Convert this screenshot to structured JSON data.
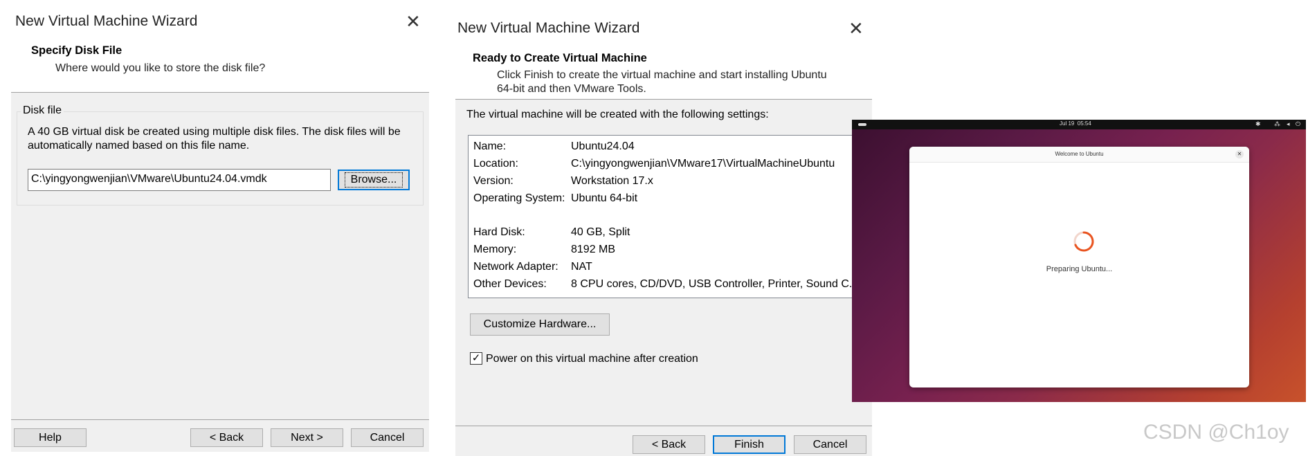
{
  "wizard1": {
    "title": "New Virtual Machine Wizard",
    "section_title": "Specify Disk File",
    "section_subtitle": "Where would you like to store the disk file?",
    "group_label": "Disk file",
    "description_line1": "A 40 GB virtual disk be created using multiple disk files. The disk files will be",
    "description_line2": "automatically named based on this file name.",
    "path_value": "C:\\yingyongwenjian\\VMware\\Ubuntu24.04.vmdk",
    "browse_label": "Browse...",
    "help_label": "Help",
    "back_label": "< Back",
    "next_label": "Next >",
    "cancel_label": "Cancel"
  },
  "wizard2": {
    "title": "New Virtual Machine Wizard",
    "section_title": "Ready to Create Virtual Machine",
    "section_subtitle_line1": "Click Finish to create the virtual machine and start installing Ubuntu",
    "section_subtitle_line2": "64-bit and then VMware Tools.",
    "settings_intro": "The virtual machine will be created with the following settings:",
    "settings": [
      {
        "key": "Name:",
        "value": "Ubuntu24.04"
      },
      {
        "key": "Location:",
        "value": "C:\\yingyongwenjian\\VMware17\\VirtualMachineUbuntu"
      },
      {
        "key": "Version:",
        "value": "Workstation 17.x"
      },
      {
        "key": "Operating System:",
        "value": "Ubuntu 64-bit"
      },
      {
        "key": "Hard Disk:",
        "value": "40 GB, Split"
      },
      {
        "key": "Memory:",
        "value": "8192 MB"
      },
      {
        "key": "Network Adapter:",
        "value": "NAT"
      },
      {
        "key": "Other Devices:",
        "value": "8 CPU cores, CD/DVD, USB Controller, Printer, Sound C..."
      }
    ],
    "customize_label": "Customize Hardware...",
    "power_on_label": "Power on this virtual machine after creation",
    "power_on_checked": true,
    "back_label": "< Back",
    "finish_label": "Finish",
    "cancel_label": "Cancel"
  },
  "ubuntu": {
    "topbar_time": "Jul 19  05:54",
    "window_title": "Welcome to Ubuntu",
    "status_text": "Preparing Ubuntu..."
  },
  "watermark": "CSDN @Ch1oy"
}
